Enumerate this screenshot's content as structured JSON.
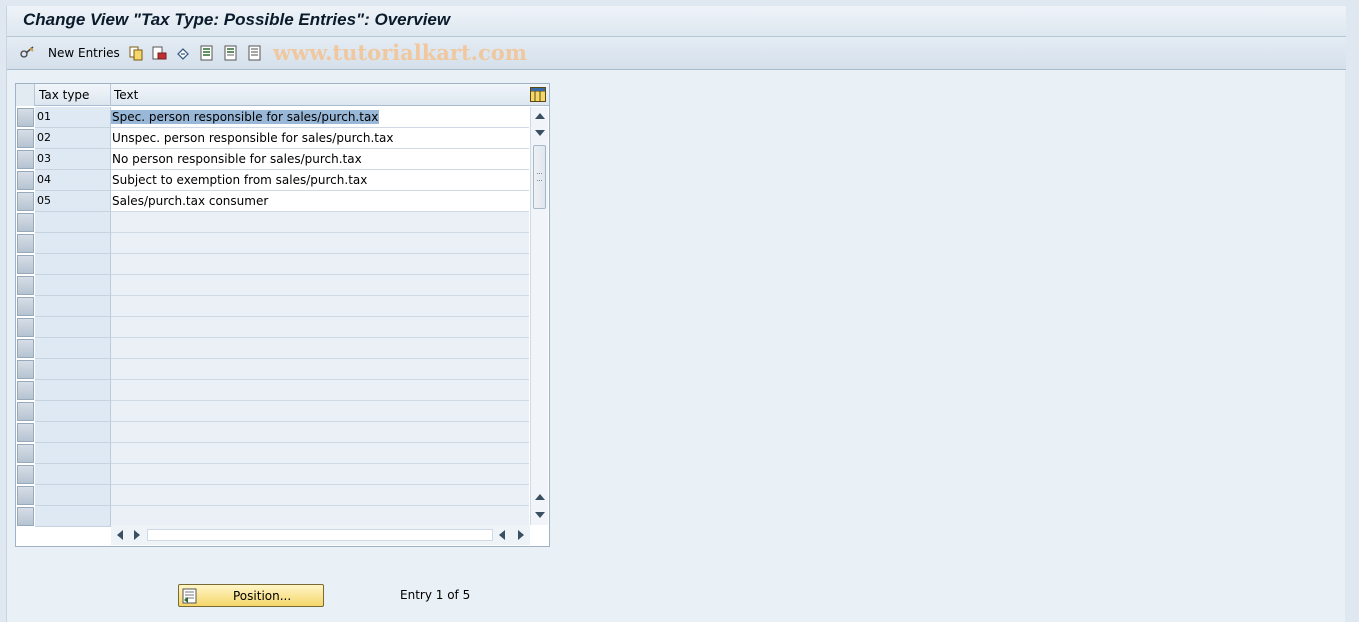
{
  "window": {
    "title": "Change View \"Tax Type: Possible Entries\": Overview"
  },
  "toolbar": {
    "new_entries_label": "New Entries",
    "watermark": "www.tutorialkart.com",
    "icons": [
      "edit-glasses-icon",
      "copy-icon",
      "delete-icon",
      "undo-icon",
      "select-all-icon",
      "select-block-icon",
      "deselect-all-icon"
    ]
  },
  "table": {
    "columns": [
      "Tax type",
      "Text"
    ],
    "rows": [
      {
        "tax_type": "01",
        "text": "Spec. person responsible for sales/purch.tax"
      },
      {
        "tax_type": "02",
        "text": "Unspec. person responsible for sales/purch.tax"
      },
      {
        "tax_type": "03",
        "text": "No person responsible for sales/purch.tax"
      },
      {
        "tax_type": "04",
        "text": "Subject to exemption from sales/purch.tax"
      },
      {
        "tax_type": "05",
        "text": "Sales/purch.tax consumer"
      }
    ],
    "selected_row": 0
  },
  "footer": {
    "position_button": "Position...",
    "entry_info": "Entry 1 of 5"
  },
  "colors": {
    "selection": "#99b8d8",
    "button_yellow": "#f5d66a",
    "watermark": "#f0c8a0"
  }
}
